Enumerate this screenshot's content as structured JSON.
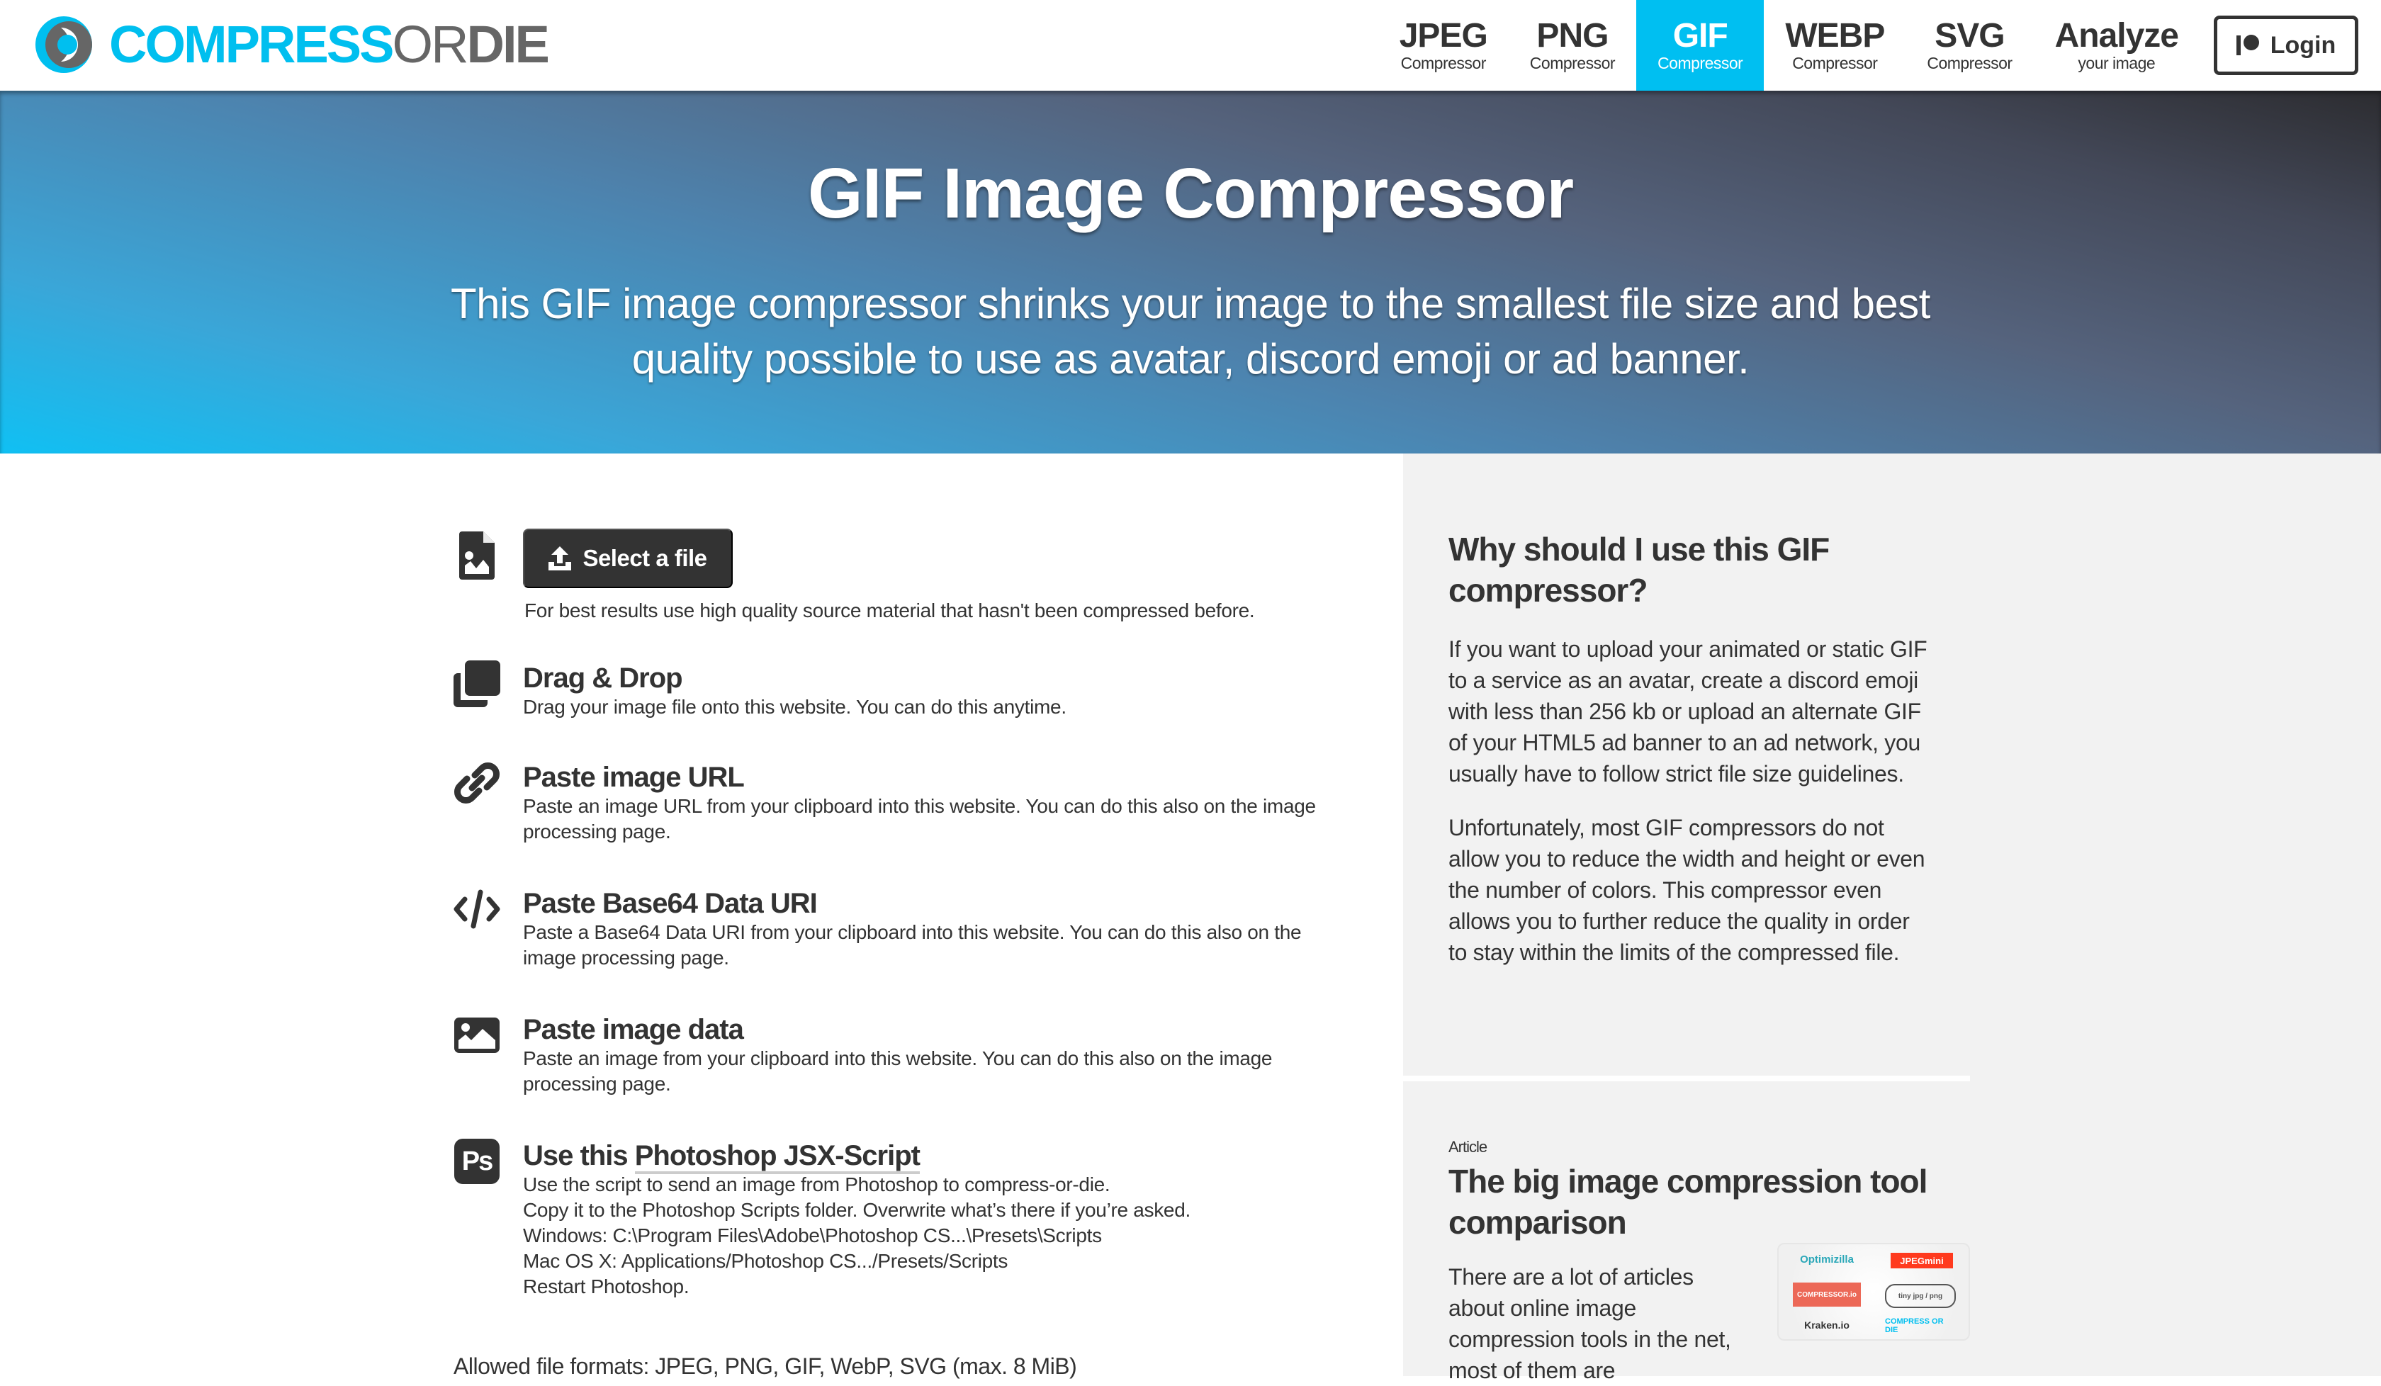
{
  "brand": {
    "logo_parts": [
      "COMPRESS",
      "OR",
      "DIE"
    ],
    "colors": {
      "accent": "#00bff1",
      "text": "#333333",
      "logo_gray": "#666666",
      "sidebar_bg": "#f2f2f2"
    }
  },
  "nav": {
    "items": [
      {
        "main": "JPEG",
        "sub": "Compressor",
        "active": false
      },
      {
        "main": "PNG",
        "sub": "Compressor",
        "active": false
      },
      {
        "main": "GIF",
        "sub": "Compressor",
        "active": true
      },
      {
        "main": "WEBP",
        "sub": "Compressor",
        "active": false
      },
      {
        "main": "SVG",
        "sub": "Compressor",
        "active": false
      },
      {
        "main": "Analyze",
        "sub": "your image",
        "active": false
      }
    ],
    "login_label": "Login",
    "login_icon": "patreon-icon"
  },
  "hero": {
    "title": "GIF Image Compressor",
    "subtitle": "This GIF image compressor shrinks your image to the smallest file size and best quality possible to use as avatar, discord emoji or ad banner."
  },
  "upload": {
    "select_button": "Select a file",
    "select_icon": "upload-icon",
    "file_icon": "file-image-icon",
    "hint": "For best results use high quality source material that hasn't been compressed before.",
    "options": [
      {
        "icon": "copy-icon",
        "title": "Drag & Drop",
        "desc": [
          "Drag your image file onto this website. You can do this anytime."
        ]
      },
      {
        "icon": "link-icon",
        "title": "Paste image URL",
        "desc": [
          "Paste an image URL from your clipboard into this website. You can do this also on the image",
          "processing page."
        ]
      },
      {
        "icon": "code-icon",
        "title": "Paste Base64 Data URI",
        "desc": [
          "Paste a Base64 Data URI from your clipboard into this website. You can do this also on the",
          "image processing page."
        ]
      },
      {
        "icon": "image-icon",
        "title": "Paste image data",
        "desc": [
          "Paste an image from your clipboard into this website. You can do this also on the image",
          "processing page."
        ]
      }
    ],
    "photoshop": {
      "icon": "photoshop-icon",
      "icon_text": "Ps",
      "title_prefix": "Use this ",
      "title_link": "Photoshop JSX-Script",
      "lines": [
        "Use the script to send an image from Photoshop to compress-or-die.",
        "Copy it to the Photoshop Scripts folder. Overwrite what’s there if you’re asked.",
        "Windows: C:\\Program Files\\Adobe\\Photoshop CS...\\Presets\\Scripts",
        "Mac OS X: Applications/Photoshop CS.../Presets/Scripts",
        "Restart Photoshop."
      ]
    },
    "allowed_formats": "Allowed file formats: JPEG, PNG, GIF, WebP, SVG (max. 8 MiB)"
  },
  "sidebar": {
    "why": {
      "heading": "Why should I use this GIF compressor?",
      "paragraphs": [
        "If you want to upload your animated or static GIF to a service as an avatar, create a discord emoji with less than 256 kb or upload an alternate GIF of your HTML5 ad banner to an ad network, you usually have to follow strict file size guidelines.",
        "Unfortunately, most GIF compressors do not allow you to reduce the width and height or even the number of colors. This compressor even allows you to further reduce the quality in order to stay within the limits of the compressed file."
      ]
    },
    "article": {
      "kicker": "Article",
      "heading": "The big image compression tool comparison",
      "text": "There are a lot of articles about online image compression tools in the net, most of them are",
      "thumb_logos": [
        "Optimizilla",
        "JPEGmini",
        "Compressor.io",
        "TinyJPG / TinyPNG",
        "Kraken.io",
        "Compress or Die"
      ]
    }
  }
}
